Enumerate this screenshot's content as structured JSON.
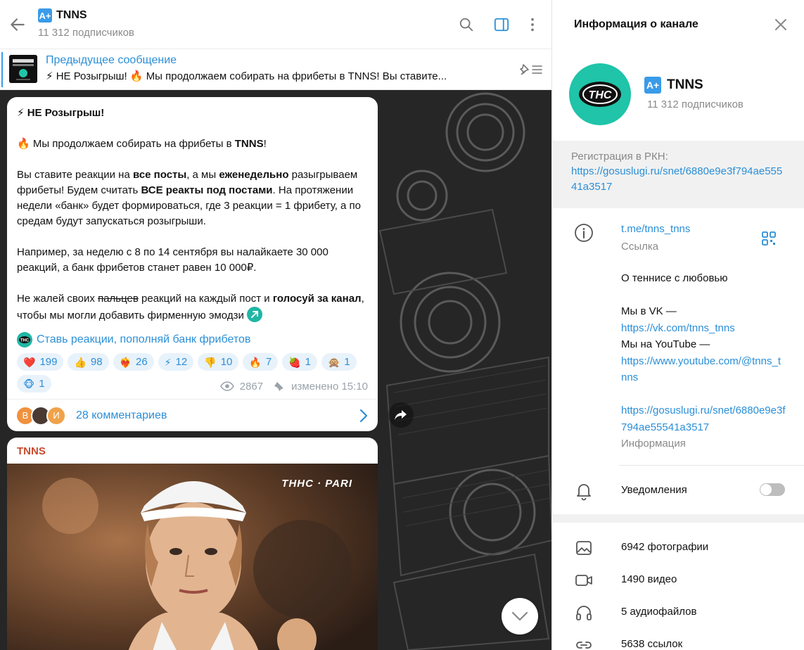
{
  "chat": {
    "header": {
      "badge": "A+",
      "title": "TNNS",
      "subtitle": "11 312 подписчиков"
    },
    "pinned": {
      "title": "Предыдущее сообщение",
      "text": "⚡ НЕ Розыгрыш!  🔥 Мы продолжаем собирать на фрибеты в TNNS!  Вы ставите..."
    },
    "post": {
      "line1": "НЕ Розыгрыш!",
      "line2_a": "Мы продолжаем собирать на фрибеты в ",
      "line2_b": "TNNS",
      "line2_c": "!",
      "p3_a": "Вы ставите реакции на ",
      "p3_b": "все посты",
      "p3_c": ", а мы ",
      "p3_d": "еженедельно",
      "p3_e": " разыгрываем фрибеты! Будем считать ",
      "p3_f": "ВСЕ реакты под постами",
      "p3_g": ". На протяжении недели «банк» будет формироваться, где 3 реакции = 1 фрибету, а по средам будут запускаться розыгрыши.",
      "p4": "Например, за неделю с 8 по 14 сентября вы налайкаете 30 000 реакций, а банк фрибетов станет равен 10 000₽.",
      "p5_a": "Не жалей своих ",
      "p5_b": "пальцев",
      "p5_c": " реакций на каждый пост и ",
      "p5_d": "голосуй за канал",
      "p5_e": ", чтобы мы могли добавить фирменную эмодзи",
      "inline_link": "Ставь реакции, пополняй банк фрибетов",
      "reactions": [
        {
          "emoji": "❤️",
          "count": "199"
        },
        {
          "emoji": "👍",
          "count": "98"
        },
        {
          "emoji": "❤️‍🔥",
          "count": "26"
        },
        {
          "emoji": "⚡",
          "count": "12"
        },
        {
          "emoji": "👎",
          "count": "10"
        },
        {
          "emoji": "🔥",
          "count": "7"
        },
        {
          "emoji": "🍓",
          "count": "1"
        },
        {
          "emoji": "🙊",
          "count": "1"
        },
        {
          "emoji": "🐵",
          "count": "1"
        }
      ],
      "views": "2867",
      "edited": "изменено 15:10",
      "comments": "28 комментариев",
      "avatars": [
        "В",
        "",
        "И"
      ]
    },
    "next_post": {
      "author": "TNNS",
      "watermark": "ТННС · PARI"
    }
  },
  "info": {
    "title": "Информация о канале",
    "name": "TNNS",
    "subscribers": "11 312 подписчиков",
    "rkn_label": "Регистрация в РКН:",
    "rkn_link": "https://gosuslugi.ru/snet/6880e9e3f794ae55541a3517",
    "link": "t.me/tnns_tnns",
    "link_label": "Ссылка",
    "about_1": "О теннисе с любовью",
    "about_vk": "Мы в VK —",
    "vk_link": "https://vk.com/tnns_tnns",
    "about_yt": "Мы на YouTube —",
    "yt_link": "https://www.youtube.com/@tnns_tnns",
    "gos_link": "https://gosuslugi.ru/snet/6880e9e3f794ae55541a3517",
    "about_label": "Информация",
    "notifications": "Уведомления",
    "media": [
      {
        "icon": "photo-icon",
        "label": "6942 фотографии"
      },
      {
        "icon": "video-icon",
        "label": "1490 видео"
      },
      {
        "icon": "headphones-icon",
        "label": "5 аудиофайлов"
      },
      {
        "icon": "link-icon",
        "label": "5638 ссылок"
      }
    ]
  },
  "colors": {
    "accent": "#2b8fd7",
    "reaction_bg": "#e8f2fb",
    "brand_teal": "#1fc4a9"
  }
}
